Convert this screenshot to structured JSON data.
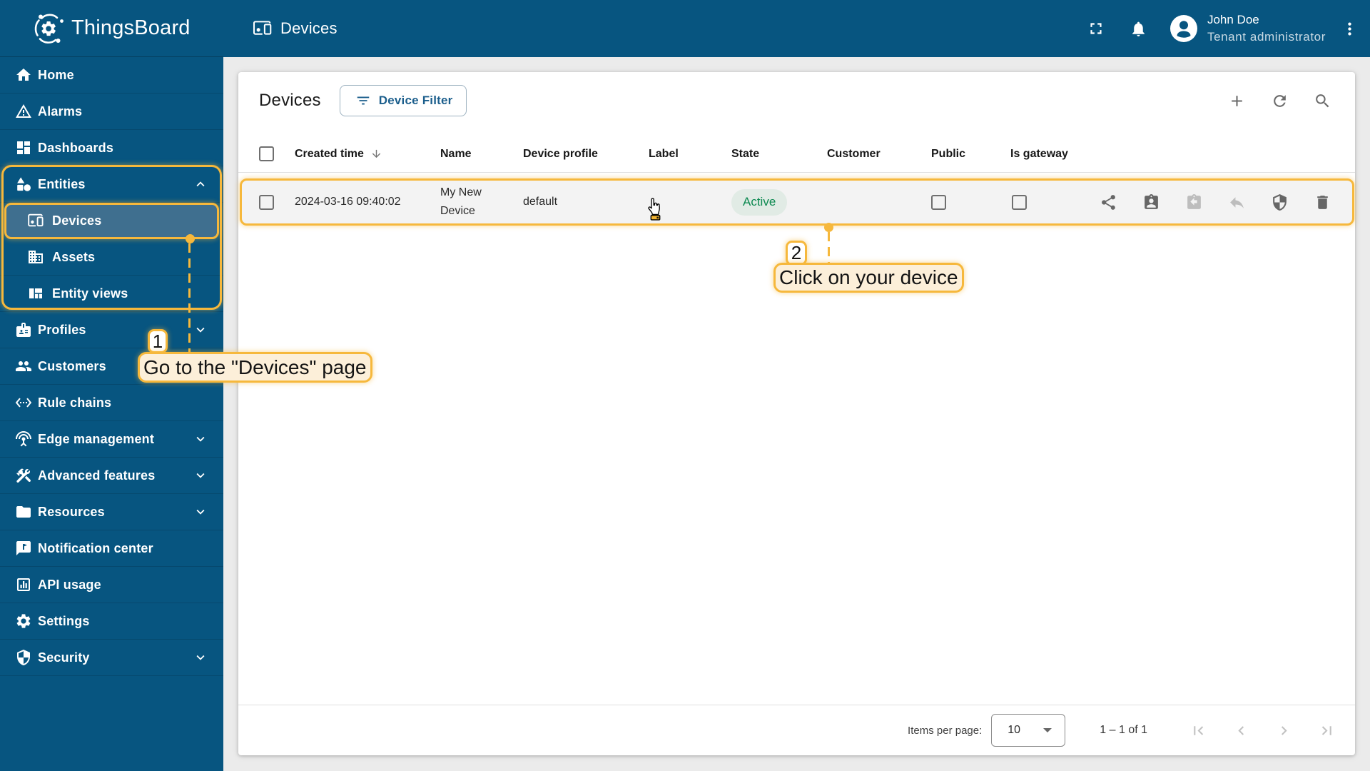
{
  "app": {
    "name": "ThingsBoard"
  },
  "sidebar": {
    "items": [
      {
        "label": "Home",
        "icon": "home"
      },
      {
        "label": "Alarms",
        "icon": "alarm-warning"
      },
      {
        "label": "Dashboards",
        "icon": "dashboards"
      },
      {
        "label": "Entities",
        "icon": "entities-shapes",
        "chevron": "up"
      },
      {
        "label": "Devices",
        "icon": "devices",
        "sub": true,
        "selected": true
      },
      {
        "label": "Assets",
        "icon": "assets-building",
        "sub": true
      },
      {
        "label": "Entity views",
        "icon": "entity-views",
        "sub": true
      },
      {
        "label": "Profiles",
        "icon": "profiles-badge",
        "chevron": "down"
      },
      {
        "label": "Customers",
        "icon": "customers-people"
      },
      {
        "label": "Rule chains",
        "icon": "rule-chains"
      },
      {
        "label": "Edge management",
        "icon": "edge-antenna",
        "chevron": "down"
      },
      {
        "label": "Advanced features",
        "icon": "advanced-tools",
        "chevron": "down"
      },
      {
        "label": "Resources",
        "icon": "resources-folder",
        "chevron": "down"
      },
      {
        "label": "Notification center",
        "icon": "notification-message"
      },
      {
        "label": "API usage",
        "icon": "api-usage-chart"
      },
      {
        "label": "Settings",
        "icon": "settings-gear"
      },
      {
        "label": "Security",
        "icon": "security-shield",
        "chevron": "down"
      }
    ]
  },
  "topbar": {
    "title": "Devices",
    "user": {
      "name": "John Doe",
      "role": "Tenant administrator"
    }
  },
  "card": {
    "title": "Devices",
    "filter_button": "Device Filter"
  },
  "table": {
    "columns": [
      "Created time",
      "Name",
      "Device profile",
      "Label",
      "State",
      "Customer",
      "Public",
      "Is gateway"
    ],
    "sorted_column": "Created time",
    "rows": [
      {
        "created_time": "2024-03-16 09:40:02",
        "name": "My New Device",
        "device_profile": "default",
        "label": "",
        "state": "Active",
        "customer": "",
        "public": false,
        "is_gateway": false
      }
    ]
  },
  "footer": {
    "items_per_page_label": "Items per page:",
    "items_per_page": "10",
    "range": "1 – 1 of 1"
  },
  "tutorial": {
    "step1": {
      "number": "1",
      "text": "Go to the \"Devices\" page"
    },
    "step2": {
      "number": "2",
      "text": "Click on your device"
    }
  },
  "colors": {
    "sidebar": "#075580",
    "selected_item": "#3F6F8F",
    "tutorial_accent": "#F6B83C",
    "tutorial_label_bg": "#FCEFD9",
    "state_active_text": "#0C8950",
    "state_active_bg": "#E1EBE5"
  }
}
